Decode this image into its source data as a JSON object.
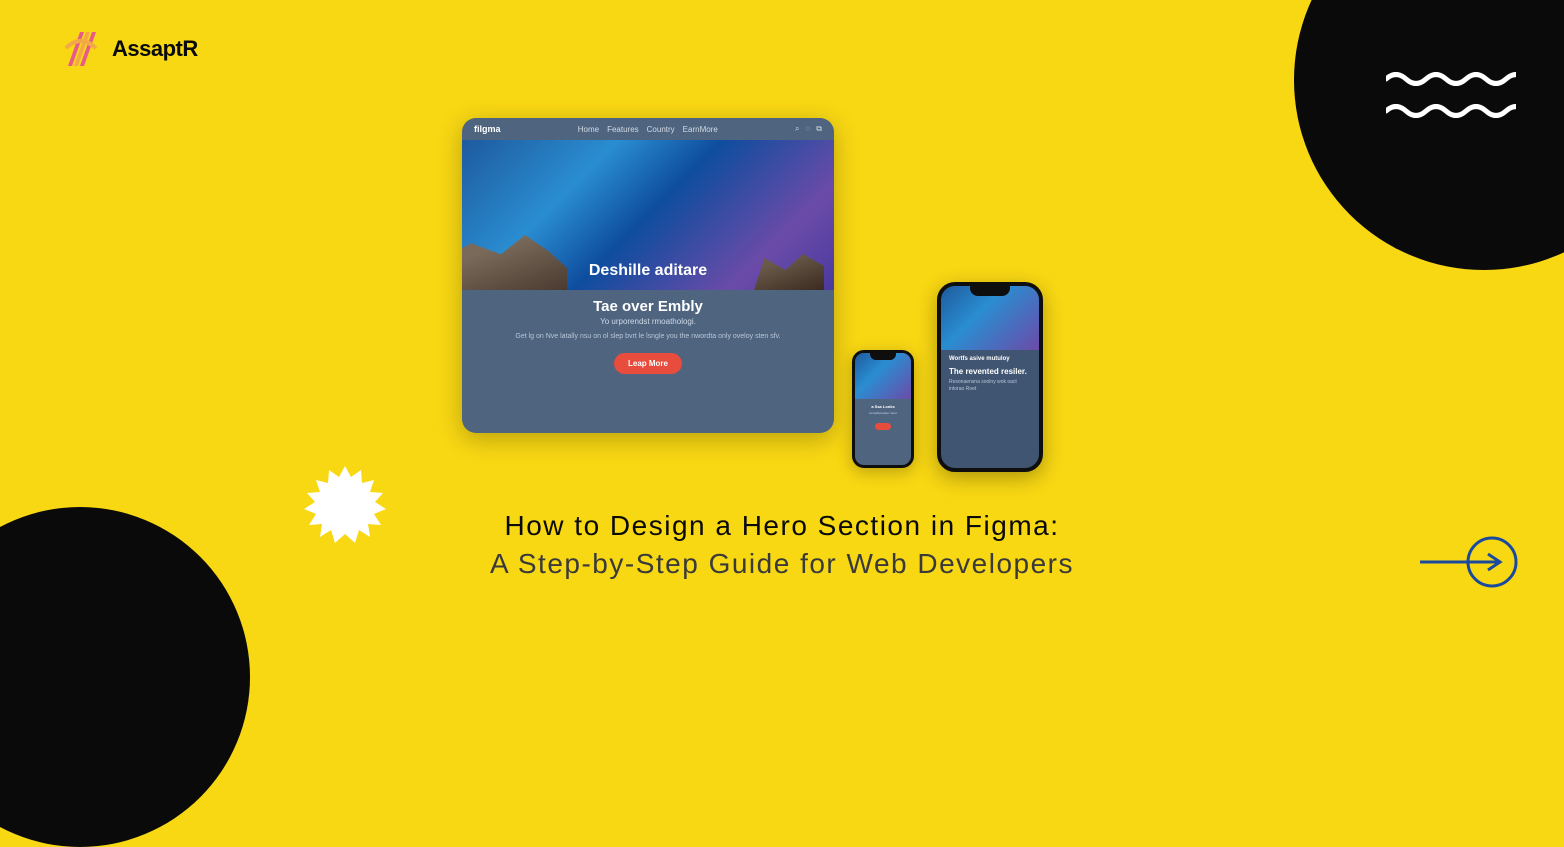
{
  "brand": {
    "name": "AssaptR"
  },
  "mockup": {
    "desktop": {
      "nav": {
        "brand": "filgma",
        "links": [
          "Home",
          "Features",
          "Country",
          "EarnMore"
        ],
        "icons": [
          "search",
          "user",
          "cart"
        ]
      },
      "hero_title": "Deshille aditare",
      "body_title": "Tae over Embly",
      "body_sub": "Yo urporendst rmoathologi.",
      "body_copy": "Get lg on Nve latally nsu on ol slep bvrt le lsngle you the nwordta only oveloy sten sfv.",
      "cta": "Leap More"
    },
    "phone_small": {
      "t1": "a Ssa Lonks",
      "t2": "bempDynuane rnool"
    },
    "phone_large": {
      "t1": "Wortfs asive mutuloy",
      "t2": "The revented resiler.",
      "copy": "Resonaensna soolny wok oact intorao Roet"
    }
  },
  "headline": {
    "line1": "How to Design a Hero Section in Figma:",
    "line2": "A Step-by-Step Guide for Web Developers"
  }
}
